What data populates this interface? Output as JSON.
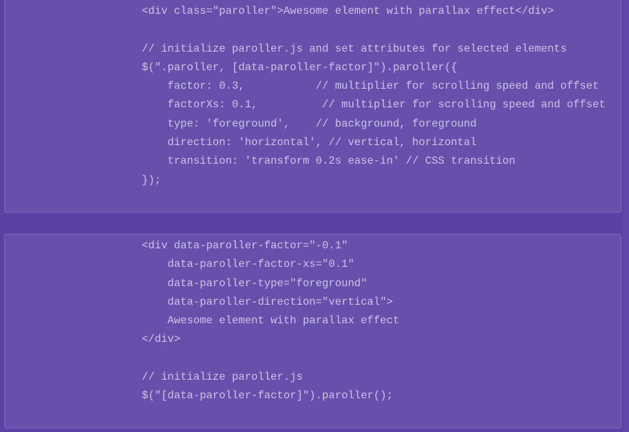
{
  "colors": {
    "background": "#5b41a3",
    "card": "#6650ab",
    "card_border": "#7c68c0",
    "code_text": "#cdc3ea"
  },
  "snippet_1": {
    "lines": [
      "<div class=\"paroller\">Awesome element with parallax effect</div>",
      "",
      "// initialize paroller.js and set attributes for selected elements",
      "$(\".paroller, [data-paroller-factor]\").paroller({",
      "    factor: 0.3,           // multiplier for scrolling speed and offset",
      "    factorXs: 0.1,          // multiplier for scrolling speed and offset",
      "    type: 'foreground',    // background, foreground",
      "    direction: 'horizontal', // vertical, horizontal",
      "    transition: 'transform 0.2s ease-in' // CSS transition",
      "});"
    ]
  },
  "snippet_2": {
    "lines": [
      "<div data-paroller-factor=\"-0.1\"",
      "    data-paroller-factor-xs=\"0.1\"",
      "    data-paroller-type=\"foreground\"",
      "    data-paroller-direction=\"vertical\">",
      "    Awesome element with parallax effect",
      "</div>",
      "",
      "// initialize paroller.js",
      "$(\"[data-paroller-factor]\").paroller();"
    ]
  }
}
